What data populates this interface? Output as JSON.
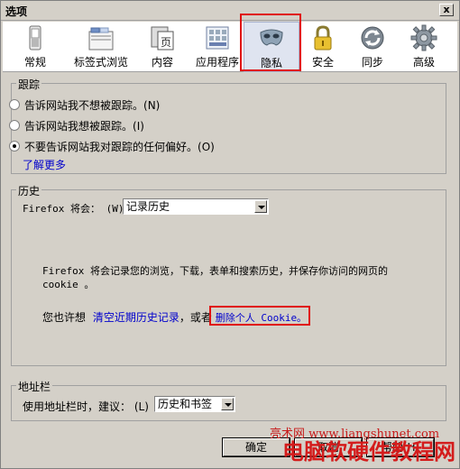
{
  "window": {
    "title": "选项",
    "close_label": "x"
  },
  "toolbar": {
    "items": [
      {
        "label": "常规",
        "icon": "switch-icon"
      },
      {
        "label": "标签式浏览",
        "icon": "tabs-icon"
      },
      {
        "label": "内容",
        "icon": "page-icon"
      },
      {
        "label": "应用程序",
        "icon": "applications-icon"
      },
      {
        "label": "隐私",
        "icon": "mask-icon",
        "selected": true
      },
      {
        "label": "安全",
        "icon": "lock-icon"
      },
      {
        "label": "同步",
        "icon": "sync-icon"
      },
      {
        "label": "高级",
        "icon": "gear-icon"
      }
    ]
  },
  "tracking": {
    "legend": "跟踪",
    "options": [
      {
        "label": "告诉网站我不想被跟踪。",
        "accel": "(N)",
        "checked": false
      },
      {
        "label": "告诉网站我想被跟踪。",
        "accel": "(I)",
        "checked": false
      },
      {
        "label": "不要告诉网站我对跟踪的任何偏好。",
        "accel": "(O)",
        "checked": true
      }
    ],
    "learn_more": "了解更多"
  },
  "history": {
    "legend": "历史",
    "firefox_will_label": "Firefox 将会：",
    "firefox_will_accel": "(W)",
    "mode_value": "记录历史",
    "description_line1": "Firefox 将会记录您的浏览，下载，表单和搜索历史，并保存你访问的网页的",
    "description_line2": "cookie 。",
    "maybe_prefix": "您也许想",
    "clear_history_link": "清空近期历史记录",
    "or_text": "，或者",
    "remove_cookies_link": "删除个人 Cookie。"
  },
  "location_bar": {
    "legend": "地址栏",
    "suggest_label": "使用地址栏时，建议：",
    "suggest_accel": "(L)",
    "suggest_value": "历史和书签"
  },
  "buttons": {
    "ok": "确定",
    "cancel": "取消",
    "help": "帮助(H)"
  },
  "watermark": {
    "small": "亮术网 www.liangshunet.com",
    "big": "电脑软硬件教程网"
  },
  "colors": {
    "highlight": "#e01010",
    "link": "#0000cc",
    "dialog_bg": "#d4d0c8"
  }
}
